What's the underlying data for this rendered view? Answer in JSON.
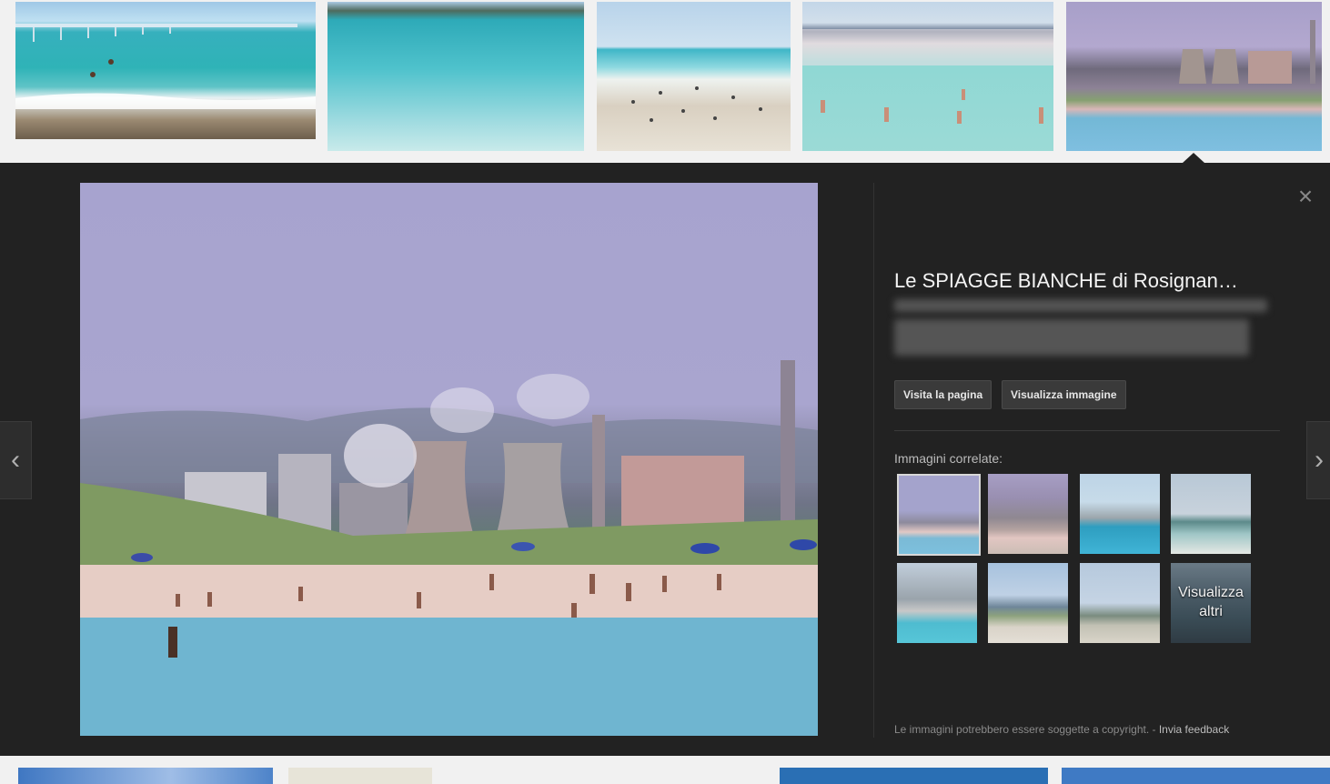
{
  "results": {
    "thumbnails": [
      {
        "name": "pier-beach-thumb"
      },
      {
        "name": "clear-water-thumb"
      },
      {
        "name": "crowded-white-beach-thumb"
      },
      {
        "name": "turquoise-bathers-thumb"
      },
      {
        "name": "factory-beach-thumb-selected"
      }
    ]
  },
  "viewer": {
    "title": "Le SPIAGGE BIANCHE di Rosignan…",
    "buttons": {
      "visit": "Visita la pagina",
      "view": "Visualizza immagine"
    },
    "related_label": "Immagini correlate:",
    "more_label": "Visualizza altri",
    "copyright": "Le immagini potrebbero essere soggette a copyright.",
    "separator": " - ",
    "feedback": "Invia feedback",
    "icons": {
      "close": "close-icon",
      "prev": "chevron-left-icon",
      "next": "chevron-right-icon"
    },
    "colors": {
      "panel_bg": "#222222",
      "page_bg": "#f1f1f1",
      "title_text": "#f4f4f4"
    }
  }
}
